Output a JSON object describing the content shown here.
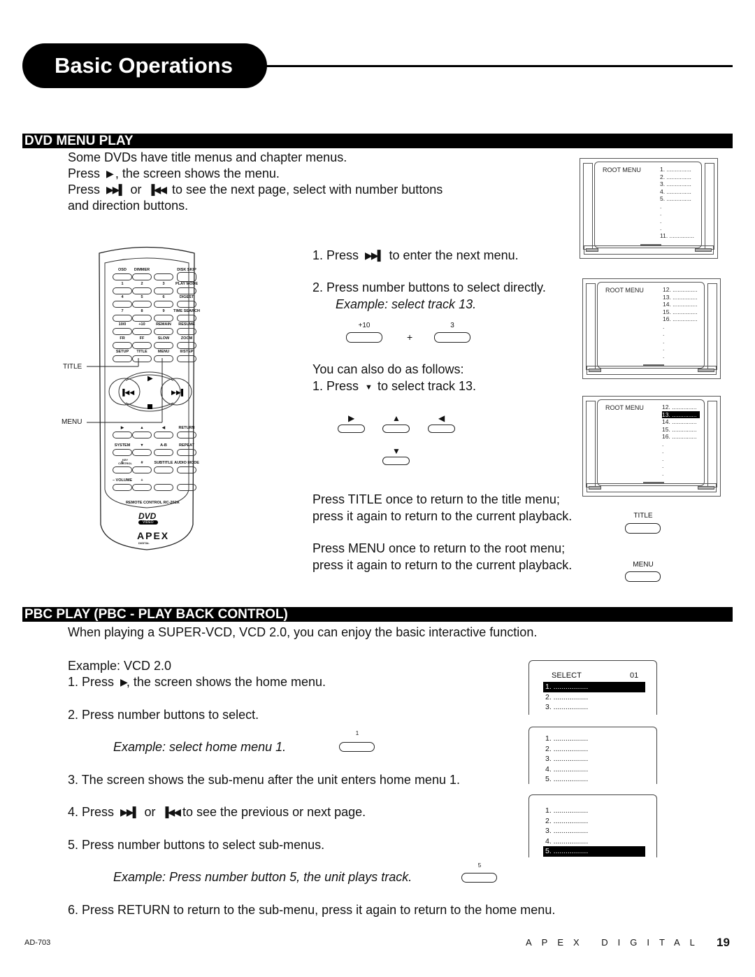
{
  "header": {
    "title": "Basic Operations"
  },
  "dvd_menu_play": {
    "heading": "DVD MENU PLAY",
    "intro": [
      "Some DVDs have title menus and chapter menus.",
      "Press",
      ", the screen shows the menu.",
      "Press",
      "or",
      "to see the next page, select with number buttons",
      "and direction buttons."
    ],
    "step1_pre": "1. Press",
    "step1_post": "to enter the next menu.",
    "step2": "2. Press number buttons to select directly.",
    "example": "Example:  select track 13.",
    "btn_plus10": "+10",
    "btn_3": "3",
    "plus": "+",
    "also": "You can also do as follows:",
    "also_step_pre": "1. Press",
    "also_step_post": "to select track 13.",
    "title_line1": "Press TITLE once to return to the title menu;",
    "title_line2": "press it again to return to the current playback.",
    "title_btn": "TITLE",
    "menu_line1": "Press MENU once to return to the root menu;",
    "menu_line2": "press it again to return to the current playback.",
    "menu_btn": "MENU",
    "icons": {
      "play": "play-icon",
      "next": "skip-next-icon",
      "prev": "skip-prev-icon",
      "down": "arrow-down-icon"
    }
  },
  "tv_screens": [
    {
      "label": "ROOT MENU",
      "items": [
        "1. ...............",
        "2. ...............",
        "3. ...............",
        "4. ...............",
        "5. ...............",
        ".",
        ".",
        ".",
        ".",
        "11. ..............."
      ],
      "highlight": null
    },
    {
      "label": "ROOT MENU",
      "items": [
        "12. ...............",
        "13. ...............",
        "14. ...............",
        "15. ...............",
        "16. ...............",
        ".",
        ".",
        ".",
        ".",
        "."
      ],
      "highlight": null
    },
    {
      "label": "ROOT MENU",
      "items": [
        "12. ...............",
        "13. ...............",
        "14. ...............",
        "15. ...............",
        "16. ...............",
        ".",
        ".",
        ".",
        ".",
        "."
      ],
      "highlight": 1
    }
  ],
  "remote": {
    "callout_title": "TITLE",
    "callout_menu": "MENU",
    "rows": [
      [
        "OSD",
        "DIMMER",
        "",
        "DISK SKIP"
      ],
      [
        "1",
        "2",
        "3",
        "PLAY MODE"
      ],
      [
        "4",
        "5",
        "6",
        "DIGEST"
      ],
      [
        "7",
        "8",
        "9",
        "TIME SEARCH"
      ],
      [
        "10/0",
        "+10",
        "REMAIN",
        "RESUME"
      ],
      [
        "FR",
        "FF",
        "SLOW",
        "ZOOM"
      ],
      [
        "SETUP",
        "TITLE",
        "MENU",
        "II/STEP"
      ]
    ],
    "rows2": [
      [
        "▶",
        "▲",
        "◀",
        "RETURN"
      ],
      [
        "SYSTEM",
        "▼",
        "A-B",
        "REPEAT"
      ],
      [
        "b",
        "#",
        "SUBTITLE",
        "AUDIO MODE"
      ],
      [
        "–  VOLUME",
        "+",
        "",
        ""
      ]
    ],
    "key_control": "KEY CONTROL",
    "model": "REMOTE CONTROL RC-202A",
    "dvd_logo": "DVD",
    "dvd_sub": "VIDEO",
    "brand_logo": "APEX",
    "brand_sub": "DIGITAL"
  },
  "pbc_play": {
    "heading": "PBC PLAY  (PBC - PLAY BACK CONTROL)",
    "intro": "When playing a SUPER-VCD, VCD 2.0, you can enjoy the basic interactive function.",
    "example_label": "Example:  VCD 2.0",
    "step1_pre": "1. Press",
    "step1_post": ", the screen shows the home menu.",
    "step2": "2. Press number buttons to select.",
    "example2": "Example:  select home menu 1.",
    "btn_1": "1",
    "step3": "3. The screen shows the sub-menu after the unit enters home menu 1.",
    "step4_pre": "4. Press",
    "step4_mid": "or",
    "step4_post": "to see the previous or next page.",
    "step5": "5. Press number buttons to select sub-menus.",
    "example5": "Example:  Press number button 5, the unit plays track.",
    "btn_5": "5",
    "step6": "6. Press RETURN to return to the sub-menu, press it again to return to the home menu."
  },
  "pbc_screens": [
    {
      "header_left": "SELECT",
      "header_right": "01",
      "items": [
        "1. .................",
        "2. .................",
        "3. ................."
      ],
      "highlight": 0
    },
    {
      "items": [
        "1. .................",
        "2. .................",
        "3. .................",
        "4. .................",
        "5. ................."
      ],
      "highlight": null
    },
    {
      "items": [
        "1. .................",
        "2. .................",
        "3. .................",
        "4. .................",
        "5. ................."
      ],
      "highlight": 4
    }
  ],
  "footer": {
    "model": "AD-703",
    "brand": "APEX DIGITAL",
    "page": "19"
  }
}
